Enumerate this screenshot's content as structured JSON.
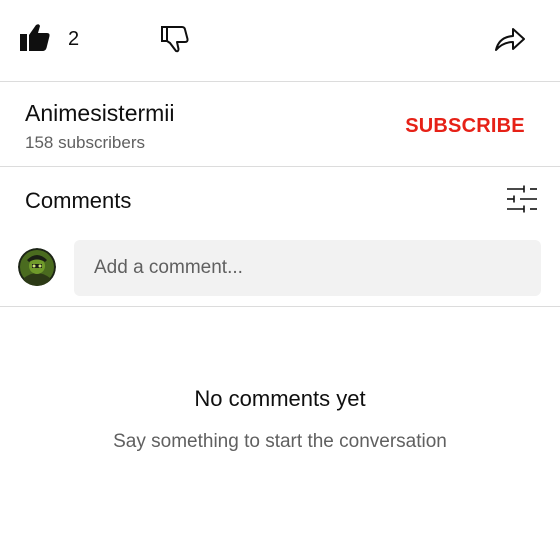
{
  "actions": {
    "like_icon": "thumbs-up-filled-icon",
    "like_count": "2",
    "dislike_icon": "thumbs-down-outline-icon",
    "share_icon": "share-arrow-icon"
  },
  "channel": {
    "name": "Animesistermii",
    "subscribers": "158 subscribers",
    "subscribe_label": "SUBSCRIBE",
    "subscribe_color": "#e62117"
  },
  "comments": {
    "heading": "Comments",
    "sort_icon": "sort-sliders-icon",
    "avatar_icon": "user-avatar",
    "input_placeholder": "Add a comment...",
    "empty_title": "No comments yet",
    "empty_subtitle": "Say something to start the conversation"
  }
}
